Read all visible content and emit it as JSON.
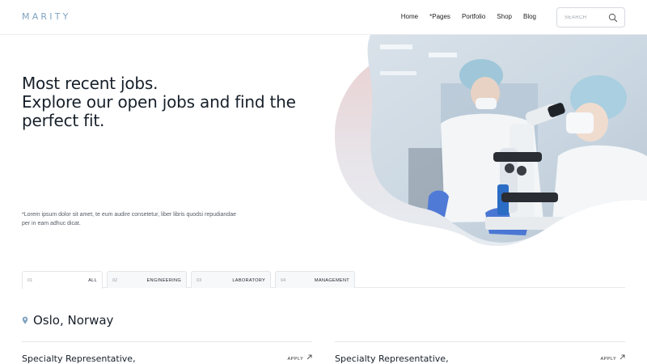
{
  "header": {
    "logo": "MARITY",
    "nav": [
      "Home",
      "Pages",
      "Portfolio",
      "Shop",
      "Blog"
    ],
    "pages_marker": "*",
    "search": {
      "placeholder": "SEARCH",
      "icon": "search-icon"
    }
  },
  "hero": {
    "title_lines": [
      "Most recent jobs.",
      "Explore our open jobs and find the",
      "perfect fit."
    ],
    "description": "*Lorem ipsum dolor sit amet, te eum audire consetetur, liber libris quodsi repudiandae per in eam adhuc dicat.",
    "image": "scientists-at-microscope-photo",
    "blob_color": "#e9d3d4"
  },
  "tabs": [
    {
      "num": "01",
      "label": "ALL",
      "active": true
    },
    {
      "num": "02",
      "label": "ENGINEERING",
      "active": false
    },
    {
      "num": "03",
      "label": "LABORATORY",
      "active": false
    },
    {
      "num": "04",
      "label": "MANAGEMENT",
      "active": false
    }
  ],
  "location": {
    "icon": "map-pin-icon",
    "name": "Oslo, Norway",
    "icon_color": "#7fa3c0"
  },
  "jobs": [
    {
      "title": "Specialty Representative,",
      "apply": "APPLY"
    },
    {
      "title": "Specialty Representative,",
      "apply": "APPLY"
    }
  ]
}
